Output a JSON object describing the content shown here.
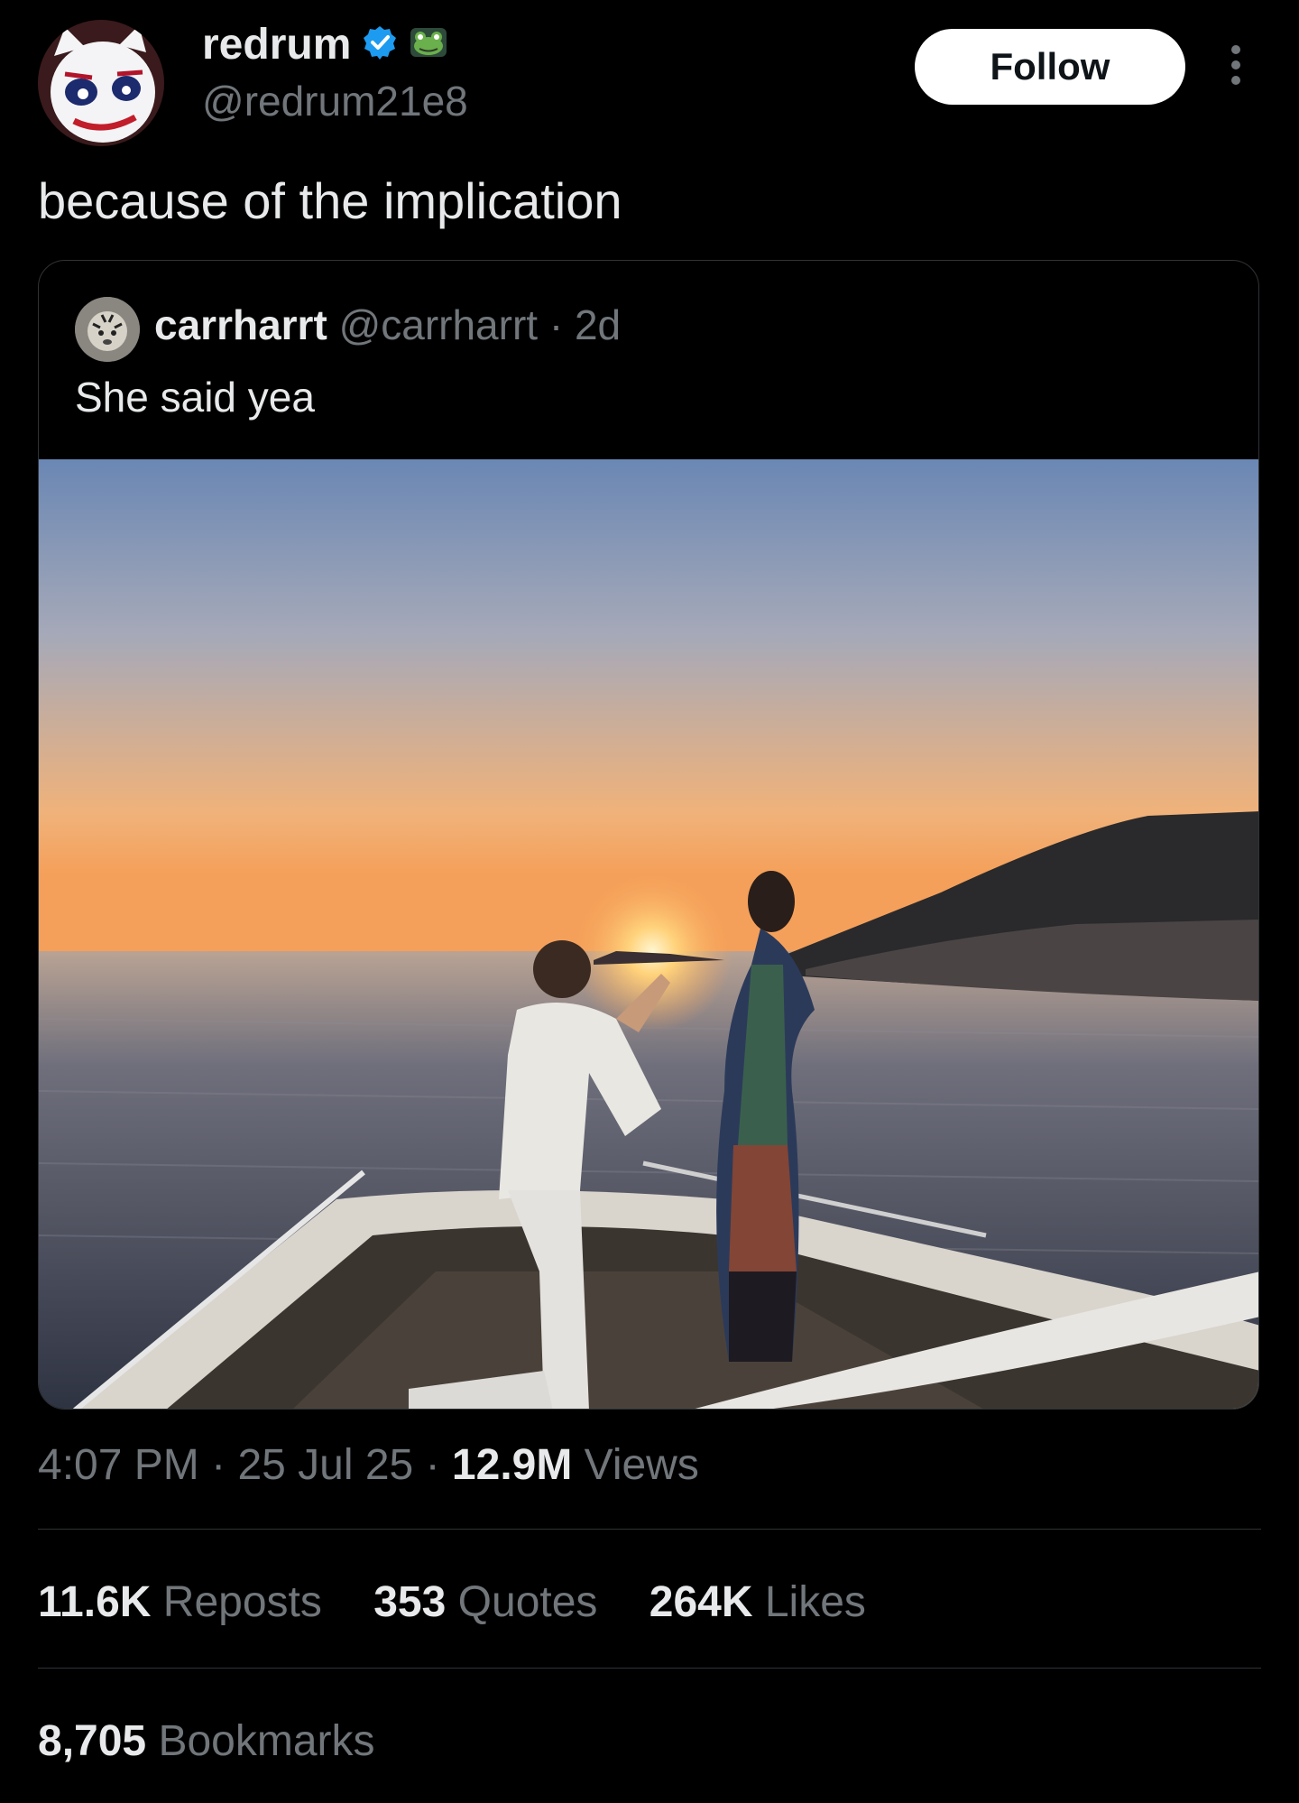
{
  "author": {
    "display_name": "redrum",
    "handle": "@redrum21e8",
    "verified_icon": "verified-badge-icon",
    "extra_badge_icon": "frog-emoji-icon",
    "verified_color": "#1d9bf0"
  },
  "follow_label": "Follow",
  "tweet_text": "because of the implication",
  "quoted": {
    "display_name": "carrharrt",
    "handle": "@carrharrt",
    "sep": "·",
    "age": "2d",
    "text": "She said yea"
  },
  "meta": {
    "time": "4:07 PM",
    "sep": "·",
    "date": "25 Jul 25",
    "views_count": "12.9M",
    "views_label": "Views"
  },
  "stats": {
    "reposts_count": "11.6K",
    "reposts_label": "Reposts",
    "quotes_count": "353",
    "quotes_label": "Quotes",
    "likes_count": "264K",
    "likes_label": "Likes",
    "bookmarks_count": "8,705",
    "bookmarks_label": "Bookmarks"
  }
}
